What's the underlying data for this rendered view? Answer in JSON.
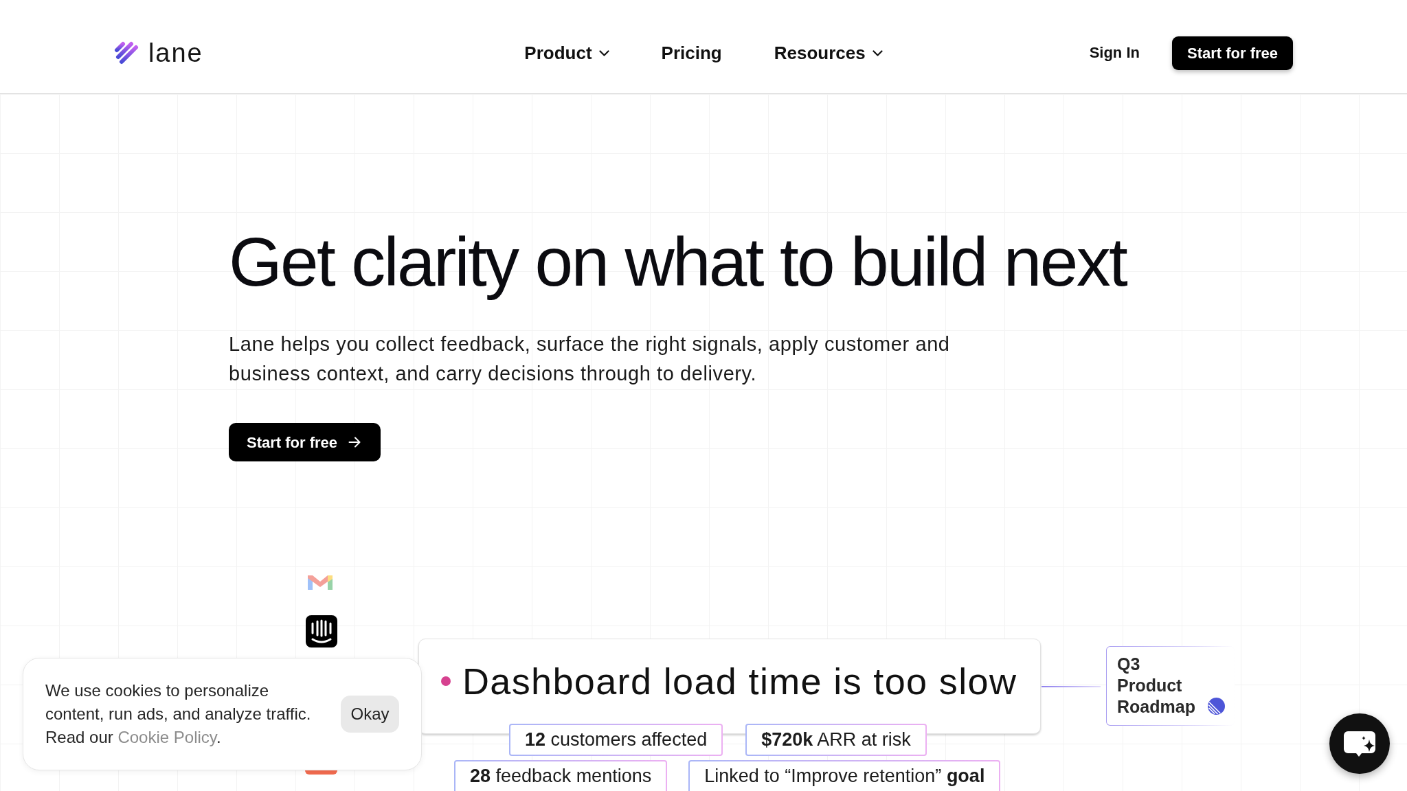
{
  "header": {
    "logo": "lane",
    "nav": [
      {
        "label": "Product",
        "has_menu": true
      },
      {
        "label": "Pricing",
        "has_menu": false
      },
      {
        "label": "Resources",
        "has_menu": true
      }
    ],
    "sign_in": "Sign In",
    "cta": "Start for free"
  },
  "hero": {
    "title": "Get clarity on what to build next",
    "description": "Lane helps you collect feedback, surface the right signals, apply customer and business context, and carry decisions through to delivery.",
    "cta": "Start for free"
  },
  "illustration": {
    "insight": "Dashboard load time is too slow",
    "metric_rows": [
      [
        "**12** customers affected",
        "**$720k** ARR at risk"
      ],
      [
        "**28** feedback mentions",
        "Linked to “Improve retention” **goal**"
      ]
    ],
    "roadmap": "Q3 Product Roadmap"
  },
  "cookie_banner": {
    "message": "We use cookies to personalize content, run ads, and analyze traffic. Read our",
    "link": "Cookie Policy",
    "message_end": ".",
    "button": "Okay"
  }
}
